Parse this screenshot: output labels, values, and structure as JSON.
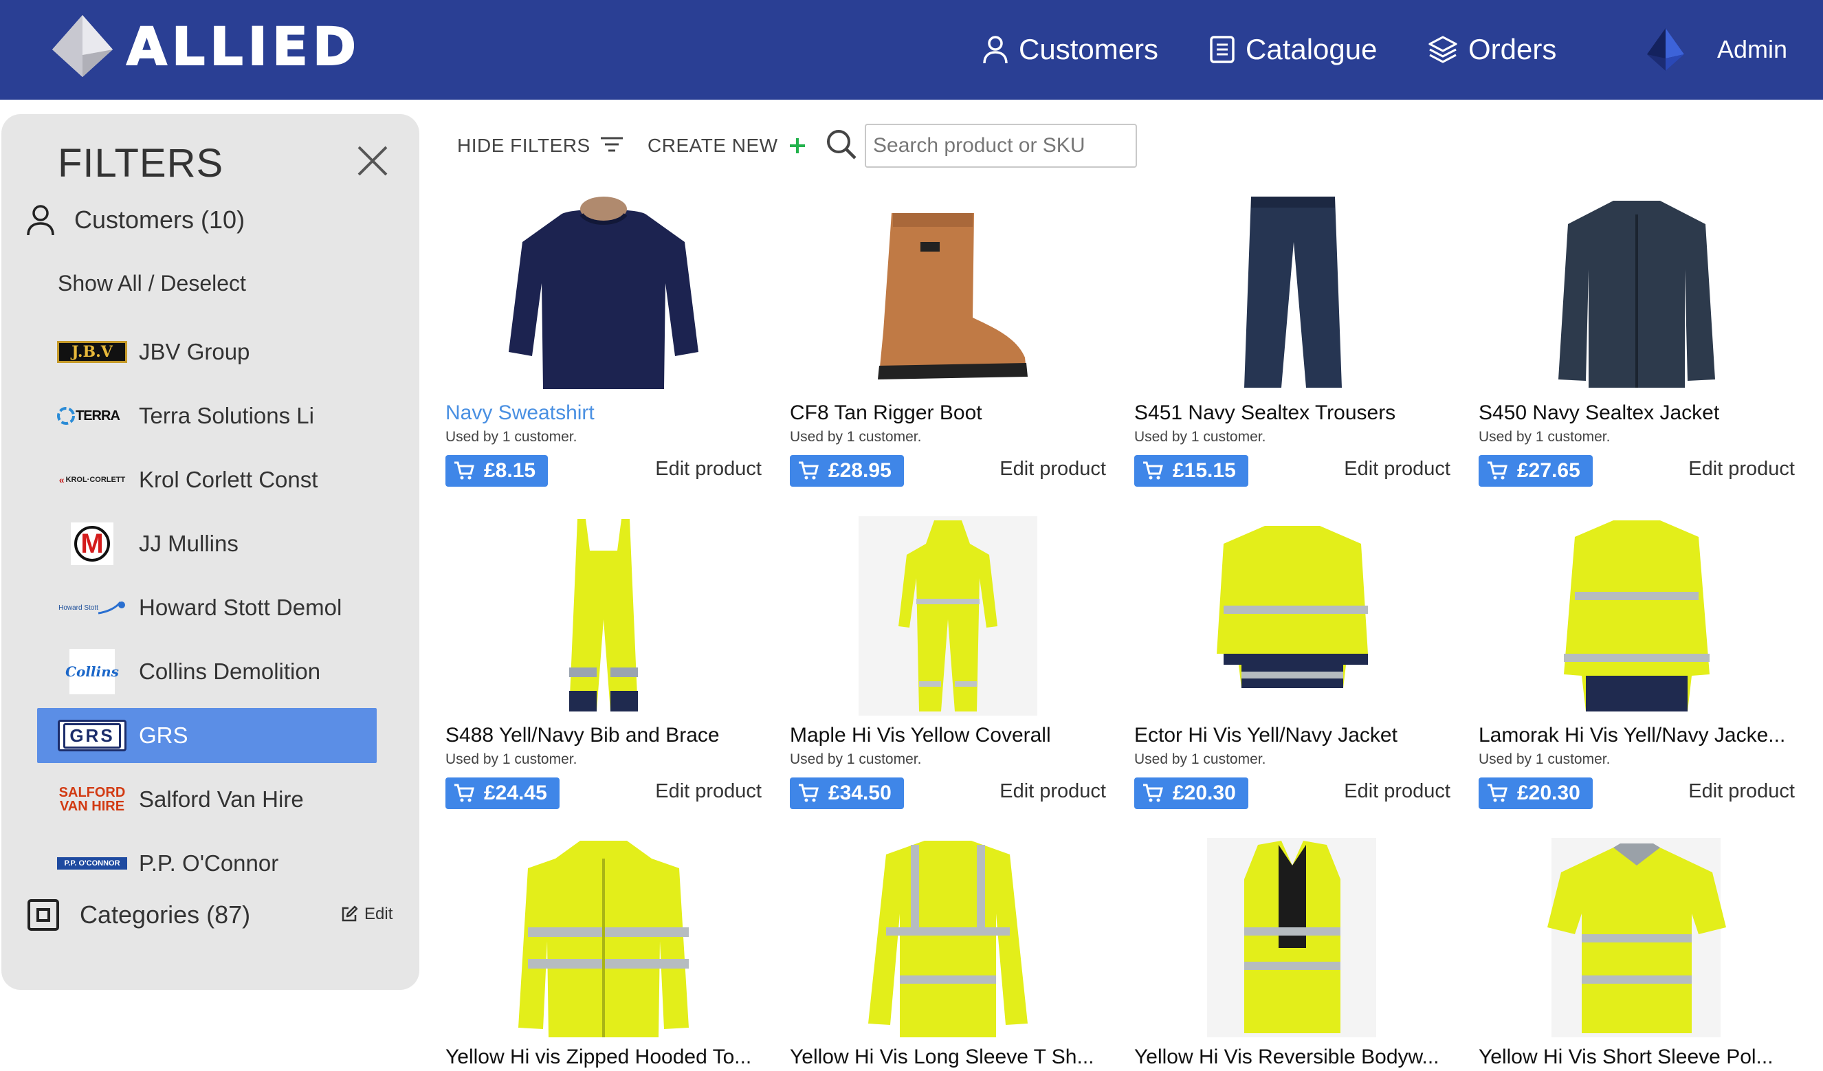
{
  "header": {
    "brand": "ALLIED",
    "nav": {
      "customers": "Customers",
      "catalogue": "Catalogue",
      "orders": "Orders",
      "admin": "Admin"
    }
  },
  "filters": {
    "title": "FILTERS",
    "customers_label": "Customers (10)",
    "show_all": "Show All / Deselect",
    "customers": [
      {
        "name": "JBV Group",
        "logo_text": "J.B.V",
        "active": false
      },
      {
        "name": "Terra Solutions Li",
        "logo_text": "TERRA",
        "active": false
      },
      {
        "name": "Krol Corlett Const",
        "logo_text": "KROL·CORLETT",
        "active": false
      },
      {
        "name": "JJ Mullins",
        "logo_text": "M",
        "active": false
      },
      {
        "name": "Howard Stott Demol",
        "logo_text": "Howard Stott",
        "active": false
      },
      {
        "name": "Collins Demolition",
        "logo_text": "Collins",
        "active": false
      },
      {
        "name": "GRS",
        "logo_text": "GRS",
        "active": true
      },
      {
        "name": "Salford Van Hire",
        "logo_text": "SALFORD VAN HIRE",
        "active": false
      },
      {
        "name": "P.P. O'Connor",
        "logo_text": "P.P. O'CONNOR",
        "active": false
      }
    ],
    "categories_label": "Categories (87)",
    "categories_edit": "Edit"
  },
  "toolbar": {
    "hide_filters": "HIDE FILTERS",
    "create_new": "CREATE NEW",
    "search_placeholder": "Search product or SKU"
  },
  "products": [
    {
      "name": "Navy Sweatshirt",
      "used": "Used by 1 customer.",
      "price": "£8.15",
      "edit": "Edit product"
    },
    {
      "name": "CF8 Tan Rigger Boot",
      "used": "Used by 1 customer.",
      "price": "£28.95",
      "edit": "Edit product"
    },
    {
      "name": "S451 Navy Sealtex Trousers",
      "used": "Used by 1 customer.",
      "price": "£15.15",
      "edit": "Edit product"
    },
    {
      "name": "S450 Navy Sealtex Jacket",
      "used": "Used by 1 customer.",
      "price": "£27.65",
      "edit": "Edit product"
    },
    {
      "name": "S488 Yell/Navy Bib and Brace",
      "used": "Used by 1 customer.",
      "price": "£24.45",
      "edit": "Edit product"
    },
    {
      "name": "Maple Hi Vis Yellow Coverall",
      "used": "Used by 1 customer.",
      "price": "£34.50",
      "edit": "Edit product"
    },
    {
      "name": "Ector Hi Vis Yell/Navy Jacket",
      "used": "Used by 1 customer.",
      "price": "£20.30",
      "edit": "Edit product"
    },
    {
      "name": "Lamorak Hi Vis Yell/Navy Jacke...",
      "used": "Used by 1 customer.",
      "price": "£20.30",
      "edit": "Edit product"
    },
    {
      "name": "Yellow Hi vis Zipped Hooded To...",
      "used": "",
      "price": "",
      "edit": ""
    },
    {
      "name": "Yellow Hi Vis Long Sleeve T Sh...",
      "used": "",
      "price": "",
      "edit": ""
    },
    {
      "name": "Yellow Hi Vis Reversible Bodyw...",
      "used": "",
      "price": "",
      "edit": ""
    },
    {
      "name": "Yellow Hi Vis Short Sleeve Pol...",
      "used": "",
      "price": "",
      "edit": ""
    }
  ],
  "colors": {
    "header": "#2a3f94",
    "accent": "#3f86e8",
    "active_filter": "#5b8ee6",
    "link": "#4a90e2",
    "hivis": "#d9f021",
    "navy": "#1f2a4f"
  }
}
